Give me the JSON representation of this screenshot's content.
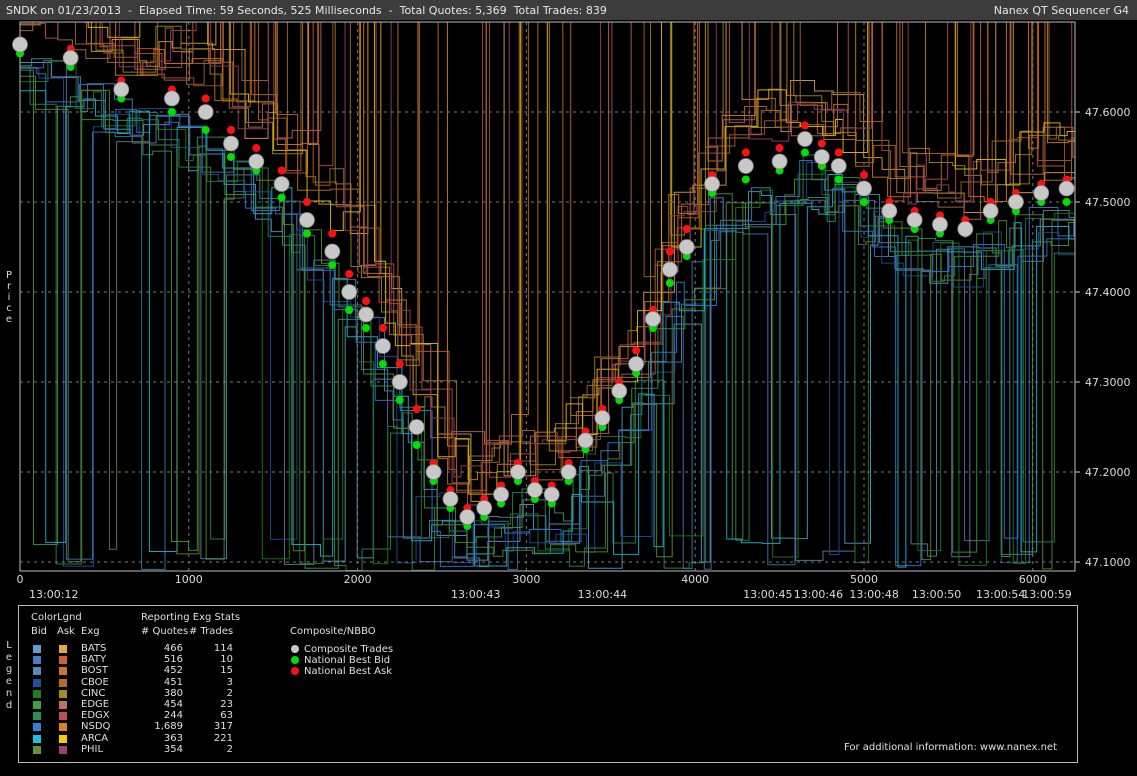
{
  "header": {
    "info": "SNDK on 01/23/2013  -  Elapsed Time: 59 Seconds, 525 Milliseconds  -  Total Quotes: 5,369  Total Trades: 839",
    "app": "Nanex QT Sequencer G4"
  },
  "y_axis_label": "Price",
  "legend_side_label": "Legend",
  "chart_data": {
    "type": "scatter",
    "ylabel": "Price",
    "ylim": [
      47.09,
      47.7
    ],
    "xlim": [
      0,
      6250
    ],
    "y_ticks": [
      "47.1000",
      "47.2000",
      "47.3000",
      "47.4000",
      "47.5000",
      "47.6000"
    ],
    "x_ticks": [
      "0",
      "1000",
      "2000",
      "3000",
      "4000",
      "5000",
      "6000"
    ],
    "time_labels": [
      {
        "x": 200,
        "label": "13:00:12"
      },
      {
        "x": 2700,
        "label": "13:00:43"
      },
      {
        "x": 3450,
        "label": "13:00:44"
      },
      {
        "x": 4430,
        "label": "13:00:45"
      },
      {
        "x": 4730,
        "label": "13:00:46"
      },
      {
        "x": 5060,
        "label": "13:00:48"
      },
      {
        "x": 5430,
        "label": "13:00:50"
      },
      {
        "x": 5810,
        "label": "13:00:54"
      },
      {
        "x": 6200,
        "label": "13:00:59"
      }
    ],
    "series": [
      {
        "name": "Composite Trades",
        "color": "#c8c8c8",
        "x": [
          0,
          300,
          600,
          900,
          1100,
          1250,
          1400,
          1550,
          1700,
          1850,
          1950,
          2050,
          2150,
          2250,
          2350,
          2450,
          2550,
          2650,
          2750,
          2850,
          2950,
          3050,
          3150,
          3250,
          3350,
          3450,
          3550,
          3650,
          3750,
          3850,
          3950,
          4100,
          4300,
          4500,
          4650,
          4750,
          4850,
          5000,
          5150,
          5300,
          5450,
          5600,
          5750,
          5900,
          6050,
          6200
        ],
        "y": [
          47.675,
          47.66,
          47.625,
          47.615,
          47.6,
          47.565,
          47.545,
          47.52,
          47.48,
          47.445,
          47.4,
          47.375,
          47.34,
          47.3,
          47.25,
          47.2,
          47.17,
          47.15,
          47.16,
          47.175,
          47.2,
          47.18,
          47.175,
          47.2,
          47.235,
          47.26,
          47.29,
          47.32,
          47.37,
          47.425,
          47.45,
          47.52,
          47.54,
          47.545,
          47.57,
          47.55,
          47.54,
          47.515,
          47.49,
          47.48,
          47.475,
          47.47,
          47.49,
          47.5,
          47.51,
          47.515
        ]
      },
      {
        "name": "National Best Bid",
        "color": "#00e000",
        "x": [
          0,
          300,
          600,
          900,
          1100,
          1250,
          1400,
          1550,
          1700,
          1850,
          1950,
          2050,
          2150,
          2250,
          2350,
          2450,
          2550,
          2650,
          2750,
          2850,
          2950,
          3050,
          3150,
          3250,
          3350,
          3450,
          3550,
          3650,
          3750,
          3850,
          3950,
          4100,
          4300,
          4500,
          4650,
          4750,
          4850,
          5000,
          5150,
          5300,
          5450,
          5600,
          5750,
          5900,
          6050,
          6200
        ],
        "y": [
          47.665,
          47.65,
          47.615,
          47.6,
          47.58,
          47.55,
          47.535,
          47.505,
          47.465,
          47.43,
          47.38,
          47.36,
          47.32,
          47.28,
          47.23,
          47.19,
          47.16,
          47.14,
          47.15,
          47.165,
          47.19,
          47.17,
          47.165,
          47.19,
          47.225,
          47.25,
          47.28,
          47.31,
          47.36,
          47.41,
          47.44,
          47.51,
          47.525,
          47.535,
          47.555,
          47.54,
          47.525,
          47.5,
          47.48,
          47.47,
          47.465,
          47.465,
          47.48,
          47.49,
          47.5,
          47.5
        ]
      },
      {
        "name": "National Best Ask",
        "color": "#ff1010",
        "x": [
          0,
          300,
          600,
          900,
          1100,
          1250,
          1400,
          1550,
          1700,
          1850,
          1950,
          2050,
          2150,
          2250,
          2350,
          2450,
          2550,
          2650,
          2750,
          2850,
          2950,
          3050,
          3150,
          3250,
          3350,
          3450,
          3550,
          3650,
          3750,
          3850,
          3950,
          4100,
          4300,
          4500,
          4650,
          4750,
          4850,
          5000,
          5150,
          5300,
          5450,
          5600,
          5750,
          5900,
          6050,
          6200
        ],
        "y": [
          47.68,
          47.67,
          47.635,
          47.625,
          47.615,
          47.58,
          47.56,
          47.535,
          47.5,
          47.465,
          47.42,
          47.39,
          47.36,
          47.32,
          47.27,
          47.21,
          47.18,
          47.16,
          47.17,
          47.185,
          47.21,
          47.19,
          47.185,
          47.21,
          47.245,
          47.27,
          47.3,
          47.335,
          47.38,
          47.445,
          47.47,
          47.53,
          47.555,
          47.56,
          47.585,
          47.565,
          47.555,
          47.53,
          47.5,
          47.49,
          47.485,
          47.48,
          47.5,
          47.51,
          47.52,
          47.525
        ]
      }
    ]
  },
  "legend": {
    "color_title": "ColorLgnd",
    "stats_title": "Reporting Exg Stats",
    "col_bid": "Bid",
    "col_ask": "Ask",
    "col_exg": "Exg",
    "col_quotes": "# Quotes",
    "col_trades": "# Trades",
    "composite_title": "Composite/NBBO",
    "rows": [
      {
        "exg": "BATS",
        "quotes": "466",
        "trades": "114",
        "bid": "#5aa0d8",
        "ask": "#e8a848"
      },
      {
        "exg": "BATY",
        "quotes": "516",
        "trades": "10",
        "bid": "#4a7cc0",
        "ask": "#d06030"
      },
      {
        "exg": "BOST",
        "quotes": "452",
        "trades": "15",
        "bid": "#5a8ab0",
        "ask": "#c87828"
      },
      {
        "exg": "CBOE",
        "quotes": "451",
        "trades": "3",
        "bid": "#2050a0",
        "ask": "#b07020"
      },
      {
        "exg": "CINC",
        "quotes": "380",
        "trades": "2",
        "bid": "#208020",
        "ask": "#a09020"
      },
      {
        "exg": "EDGE",
        "quotes": "454",
        "trades": "23",
        "bid": "#40a040",
        "ask": "#c07060"
      },
      {
        "exg": "EDGX",
        "quotes": "244",
        "trades": "63",
        "bid": "#309050",
        "ask": "#c05050"
      },
      {
        "exg": "NSDQ",
        "quotes": "1,689",
        "trades": "317",
        "bid": "#3080e0",
        "ask": "#e08020"
      },
      {
        "exg": "ARCA",
        "quotes": "363",
        "trades": "221",
        "bid": "#20c0e0",
        "ask": "#f0d000"
      },
      {
        "exg": "PHIL",
        "quotes": "354",
        "trades": "2",
        "bid": "#609040",
        "ask": "#a04070"
      }
    ],
    "composite": [
      {
        "label": "Composite Trades",
        "color": "#c8c8c8"
      },
      {
        "label": "National Best Bid",
        "color": "#00e000"
      },
      {
        "label": "National Best Ask",
        "color": "#ff1010"
      }
    ],
    "footer": "For additional information: www.nanex.net"
  }
}
